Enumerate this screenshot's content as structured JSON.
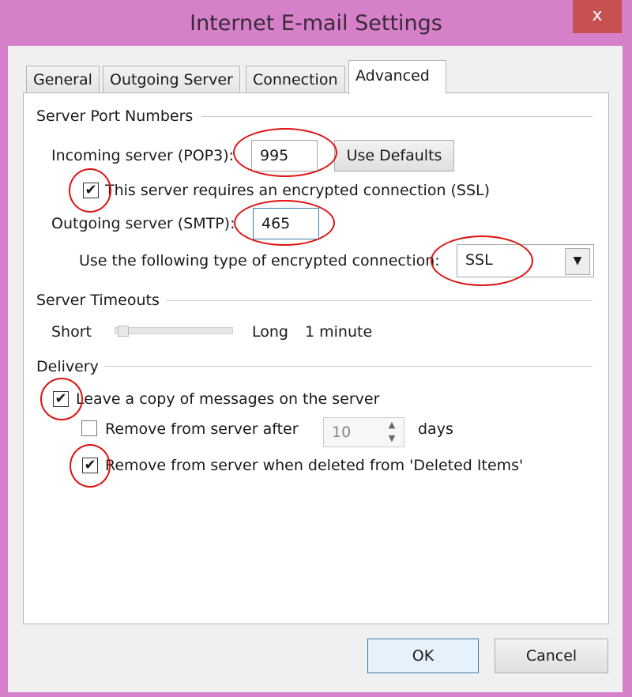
{
  "window": {
    "title": "Internet E-mail Settings",
    "close_label": "x"
  },
  "tabs": [
    {
      "label": "General"
    },
    {
      "label": "Outgoing Server"
    },
    {
      "label": "Connection"
    },
    {
      "label": "Advanced",
      "active": true
    }
  ],
  "ports": {
    "section": "Server Port Numbers",
    "incoming_label": "Incoming server (POP3):",
    "incoming_value": "995",
    "use_defaults": "Use Defaults",
    "ssl_label": "This server requires an encrypted connection (SSL)",
    "ssl_checked": true,
    "outgoing_label": "Outgoing server (SMTP):",
    "outgoing_value": "465",
    "enc_label": "Use the following type of encrypted connection:",
    "enc_value": "SSL"
  },
  "timeouts": {
    "section": "Server Timeouts",
    "short": "Short",
    "long": "Long",
    "value": "1 minute",
    "slider_fraction": 0.05
  },
  "delivery": {
    "section": "Delivery",
    "leave_copy": "Leave a copy of messages on the server",
    "leave_copy_checked": true,
    "remove_after": "Remove from server after",
    "remove_after_checked": false,
    "days_value": "10",
    "days": "days",
    "remove_deleted": "Remove from server when deleted from 'Deleted Items'",
    "remove_deleted_checked": true
  },
  "footer": {
    "ok": "OK",
    "cancel": "Cancel"
  },
  "colors": {
    "frame": "#d580c9",
    "close": "#c75050",
    "annotation": "#e01010"
  }
}
